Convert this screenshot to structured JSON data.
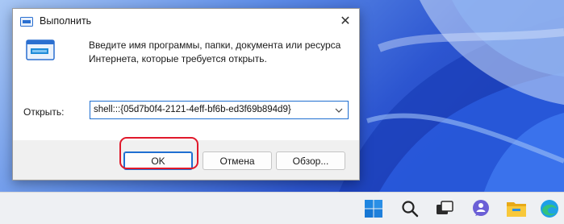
{
  "dialog": {
    "title": "Выполнить",
    "description_line1": "Введите имя программы, папки, документа или ресурса",
    "description_line2": "Интернета, которые требуется открыть.",
    "open_label": "Открыть:",
    "open_value": "shell:::{05d7b0f4-2121-4eff-bf6b-ed3f69b894d9}",
    "ok_label": "OK",
    "cancel_label": "Отмена",
    "browse_label": "Обзор...",
    "close_glyph": "✕"
  },
  "taskbar": {
    "icons": [
      "windows-start-icon",
      "search-icon",
      "task-view-icon",
      "chat-icon",
      "file-explorer-icon",
      "edge-icon"
    ]
  },
  "colors": {
    "accent": "#1f6fd1",
    "highlight": "#e0192b",
    "wallpaper": "#2c55d0"
  }
}
